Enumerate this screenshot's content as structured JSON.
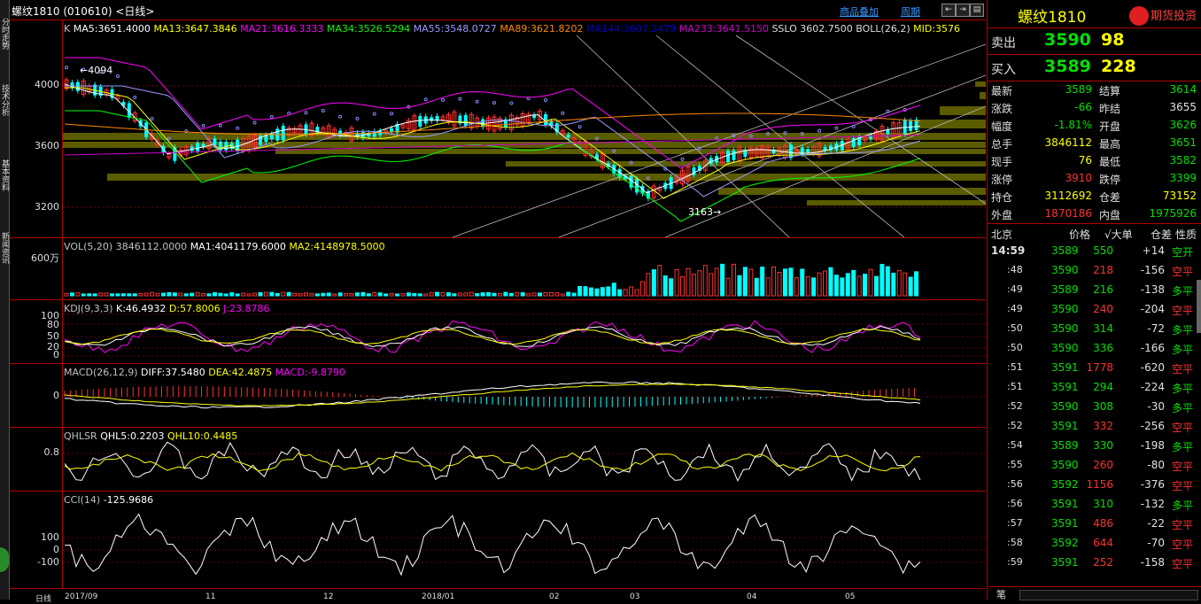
{
  "left_strip": {
    "tabs": [
      "分时走势",
      "技术分析",
      "基本资料",
      "新闻资讯"
    ]
  },
  "title_bar": {
    "title": "螺纹1810 (010610) <日线>",
    "links": [
      "商品叠加",
      "周期"
    ]
  },
  "main_chart": {
    "legend": [
      {
        "text": "K",
        "color": "#c0c0c0"
      },
      {
        "text": "MA5:3651.4000",
        "color": "#ffffff"
      },
      {
        "text": "MA13:3647.3846",
        "color": "#ffff00"
      },
      {
        "text": "MA21:3616.3333",
        "color": "#ff00ff"
      },
      {
        "text": "MA34:3526.5294",
        "color": "#00ff00"
      },
      {
        "text": "MA55:3548.0727",
        "color": "#9999ff"
      },
      {
        "text": "MA89:3621.8202",
        "color": "#ff8800"
      },
      {
        "text": "MA144:3607.2479",
        "color": "#0000cc"
      },
      {
        "text": "MA233:3641.5150",
        "color": "#cc00cc"
      },
      {
        "text": "SSLO 3602.7500",
        "color": "#dddddd"
      },
      {
        "text": "BOLL(26,2)",
        "color": "#dddddd"
      },
      {
        "text": "MID:3576",
        "color": "#ffff00"
      }
    ],
    "y_labels": [
      "4000",
      "3600",
      "3200"
    ],
    "annotations": {
      "high": "4094",
      "low": "3163"
    }
  },
  "vol_panel": {
    "legend": [
      {
        "text": "VOL(5,20)",
        "color": "#c0c0c0"
      },
      {
        "text": "3846112.0000",
        "color": "#c0c0c0"
      },
      {
        "text": "MA1:4041179.6000",
        "color": "#ffffff"
      },
      {
        "text": "MA2:4148978.5000",
        "color": "#ffff00"
      }
    ],
    "y_label": "600万"
  },
  "kdj_panel": {
    "legend": [
      {
        "text": "KDJ(9,3,3)",
        "color": "#c0c0c0"
      },
      {
        "text": "K:46.4932",
        "color": "#ffffff"
      },
      {
        "text": "D:57.8006",
        "color": "#ffff00"
      },
      {
        "text": "J:23.8786",
        "color": "#ff00ff"
      }
    ],
    "y_labels": [
      "100",
      "80",
      "50",
      "20",
      "0"
    ]
  },
  "macd_panel": {
    "legend": [
      {
        "text": "MACD(26,12,9)",
        "color": "#c0c0c0"
      },
      {
        "text": "DIFF:37.5480",
        "color": "#ffffff"
      },
      {
        "text": "DEA:42.4875",
        "color": "#ffff00"
      },
      {
        "text": "MACD:-9.8790",
        "color": "#ff00ff"
      }
    ],
    "y_label": "0"
  },
  "qhlsr_panel": {
    "legend": [
      {
        "text": "QHLSR",
        "color": "#c0c0c0"
      },
      {
        "text": "QHL5:0.2203",
        "color": "#ffffff"
      },
      {
        "text": "QHL10:0.4485",
        "color": "#ffff00"
      }
    ],
    "y_label": "0.8"
  },
  "cci_panel": {
    "legend": [
      {
        "text": "CCI(14)",
        "color": "#c0c0c0"
      },
      {
        "text": "-125.9686",
        "color": "#ffffff"
      }
    ],
    "y_labels": [
      "100",
      "0",
      "-100"
    ]
  },
  "x_axis": {
    "left_label": "日线",
    "labels": [
      "2017/09",
      "11",
      "12",
      "2018/01",
      "02",
      "03",
      "04",
      "05"
    ]
  },
  "quote": {
    "name": "螺纹1810",
    "watermark": "期货投资 setz.com",
    "sell": {
      "label": "卖出",
      "price": "3590",
      "qty": "98"
    },
    "buy": {
      "label": "买入",
      "price": "3589",
      "qty": "228"
    },
    "stats": [
      {
        "l": "最新",
        "lv": "3589",
        "lc": "green",
        "r": "结算",
        "rv": "3614",
        "rc": "green"
      },
      {
        "l": "涨跌",
        "lv": "-66",
        "lc": "green",
        "r": "昨结",
        "rv": "3655",
        "rc": "white"
      },
      {
        "l": "幅度",
        "lv": "-1.81%",
        "lc": "green",
        "r": "开盘",
        "rv": "3626",
        "rc": "green"
      },
      {
        "l": "总手",
        "lv": "3846112",
        "lc": "yellow",
        "r": "最高",
        "rv": "3651",
        "rc": "green"
      },
      {
        "l": "现手",
        "lv": "76",
        "lc": "yellow",
        "r": "最低",
        "rv": "3582",
        "rc": "green"
      },
      {
        "l": "涨停",
        "lv": "3910",
        "lc": "red",
        "r": "跌停",
        "rv": "3399",
        "rc": "green"
      },
      {
        "l": "持仓",
        "lv": "3112692",
        "lc": "yellow",
        "r": "仓差",
        "rv": "73152",
        "rc": "yellow"
      },
      {
        "l": "外盘",
        "lv": "1870186",
        "lc": "red",
        "r": "内盘",
        "rv": "1975926",
        "rc": "green"
      }
    ],
    "tick_header": {
      "time": "北京",
      "price": "价格",
      "vol": "√大单",
      "oi": "仓差",
      "nature": "性质"
    },
    "ticks": [
      {
        "t": "14:59",
        "p": "3589",
        "v": "550",
        "vc": "green",
        "oi": "+14",
        "n": "空开",
        "nc": "green"
      },
      {
        "t": ":48",
        "p": "3590",
        "v": "218",
        "vc": "red",
        "oi": "-156",
        "n": "空平",
        "nc": "red"
      },
      {
        "t": ":49",
        "p": "3589",
        "v": "216",
        "vc": "green",
        "oi": "-138",
        "n": "多平",
        "nc": "green"
      },
      {
        "t": ":49",
        "p": "3590",
        "v": "240",
        "vc": "red",
        "oi": "-204",
        "n": "空平",
        "nc": "red"
      },
      {
        "t": ":50",
        "p": "3590",
        "v": "314",
        "vc": "green",
        "oi": "-72",
        "n": "多平",
        "nc": "green"
      },
      {
        "t": ":50",
        "p": "3590",
        "v": "336",
        "vc": "green",
        "oi": "-166",
        "n": "多平",
        "nc": "green"
      },
      {
        "t": ":51",
        "p": "3591",
        "v": "1778",
        "vc": "red",
        "oi": "-620",
        "n": "空平",
        "nc": "red"
      },
      {
        "t": ":51",
        "p": "3591",
        "v": "294",
        "vc": "green",
        "oi": "-224",
        "n": "多平",
        "nc": "green"
      },
      {
        "t": ":52",
        "p": "3590",
        "v": "308",
        "vc": "green",
        "oi": "-30",
        "n": "多平",
        "nc": "green"
      },
      {
        "t": ":52",
        "p": "3591",
        "v": "332",
        "vc": "red",
        "oi": "-256",
        "n": "空平",
        "nc": "red"
      },
      {
        "t": ":54",
        "p": "3589",
        "v": "330",
        "vc": "green",
        "oi": "-198",
        "n": "多平",
        "nc": "green"
      },
      {
        "t": ":55",
        "p": "3590",
        "v": "260",
        "vc": "red",
        "oi": "-80",
        "n": "空平",
        "nc": "red"
      },
      {
        "t": ":56",
        "p": "3592",
        "v": "1156",
        "vc": "red",
        "oi": "-376",
        "n": "空平",
        "nc": "red"
      },
      {
        "t": ":56",
        "p": "3591",
        "v": "310",
        "vc": "green",
        "oi": "-132",
        "n": "多平",
        "nc": "green"
      },
      {
        "t": ":57",
        "p": "3591",
        "v": "486",
        "vc": "red",
        "oi": "-22",
        "n": "空平",
        "nc": "red"
      },
      {
        "t": ":58",
        "p": "3592",
        "v": "644",
        "vc": "red",
        "oi": "-70",
        "n": "空平",
        "nc": "red"
      },
      {
        "t": ":59",
        "p": "3591",
        "v": "252",
        "vc": "red",
        "oi": "-158",
        "n": "空平",
        "nc": "red"
      }
    ],
    "footer": "笔"
  }
}
